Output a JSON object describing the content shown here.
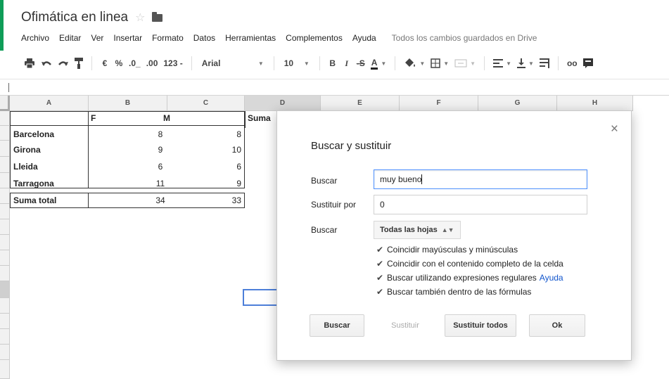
{
  "app": {
    "doc_title": "Ofimática en linea",
    "save_status": "Todos los cambios guardados en Drive",
    "accent_color": "#0f9d58"
  },
  "menu": {
    "items": [
      "Archivo",
      "Editar",
      "Ver",
      "Insertar",
      "Formato",
      "Datos",
      "Herramientas",
      "Complementos",
      "Ayuda"
    ]
  },
  "toolbar": {
    "currency": "€",
    "percent": "%",
    "decrease_decimals": ".0_",
    "increase_decimals": ".00",
    "more_formats": "123 -",
    "font_name": "Arial",
    "font_size": "10",
    "bold": "B",
    "italic": "I",
    "strikethrough": "-S",
    "text_color": "A",
    "link": "oo",
    "icons": [
      "print-icon",
      "undo-icon",
      "redo-icon",
      "paint-format-icon",
      "fill-color-icon",
      "borders-icon",
      "merge-icon",
      "align-left-icon",
      "valign-bottom-icon",
      "text-wrap-icon",
      "link-icon",
      "comment-icon"
    ]
  },
  "sheet": {
    "columns": [
      "A",
      "B",
      "C",
      "D",
      "E",
      "F",
      "G",
      "H"
    ],
    "selected_column": "D",
    "header_row": {
      "b": "F",
      "c": "M",
      "d": "Suma"
    },
    "rows": [
      {
        "label": "Barcelona",
        "f": "8",
        "m": "8"
      },
      {
        "label": "Girona",
        "f": "9",
        "m": "10"
      },
      {
        "label": "Lleida",
        "f": "6",
        "m": "6"
      },
      {
        "label": "Tarragona",
        "f": "11",
        "m": "9"
      }
    ],
    "total_row": {
      "label": "Suma total",
      "f": "34",
      "m": "33"
    }
  },
  "dialog": {
    "title": "Buscar y sustituir",
    "find_label": "Buscar",
    "find_value": "muy bueno",
    "replace_label": "Sustituir por",
    "replace_value": "0",
    "scope_label": "Buscar",
    "scope_value": "Todas las hojas",
    "options": [
      {
        "label": "Coincidir mayúsculas y minúsculas",
        "checked": true
      },
      {
        "label": "Coincidir con el contenido completo de la celda",
        "checked": true
      },
      {
        "label": "Buscar utilizando expresiones regulares",
        "checked": true
      },
      {
        "label": "Buscar también dentro de las fórmulas",
        "checked": true
      }
    ],
    "help_link": "Ayuda",
    "buttons": {
      "find": "Buscar",
      "replace": "Sustituir",
      "replace_all": "Sustituir todos",
      "ok": "Ok"
    }
  }
}
